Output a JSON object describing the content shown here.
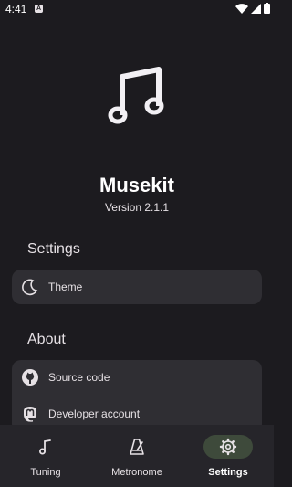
{
  "status_bar": {
    "time": "4:41",
    "notification_letter": "A"
  },
  "app": {
    "name": "Musekit",
    "version": "Version 2.1.1"
  },
  "settings_section": {
    "title": "Settings",
    "items": [
      {
        "label": "Theme",
        "icon": "moon-icon"
      }
    ]
  },
  "about_section": {
    "title": "About",
    "items": [
      {
        "label": "Source code",
        "icon": "github-icon"
      },
      {
        "label": "Developer account",
        "icon": "mastodon-icon"
      }
    ]
  },
  "bottom_nav": {
    "items": [
      {
        "label": "Tuning",
        "icon": "music-note-icon",
        "active": false
      },
      {
        "label": "Metronome",
        "icon": "metronome-icon",
        "active": false
      },
      {
        "label": "Settings",
        "icon": "gear-icon",
        "active": true
      }
    ]
  },
  "colors": {
    "background": "#1c1b1f",
    "card": "#2f2e33",
    "nav_active_pill": "#3e4a3b"
  }
}
